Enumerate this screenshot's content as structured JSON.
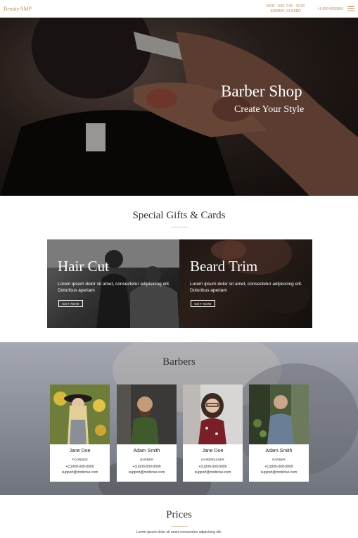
{
  "nav": {
    "brand": "BeautyAMP",
    "hours_line1": "MON - SAT: 7:00 - 10:00",
    "hours_line2": "SUNDAY: CLOSED",
    "phone": "+1-000-0000000"
  },
  "hero": {
    "title": "Barber Shop",
    "subtitle": "Create Your Style"
  },
  "gifts": {
    "title": "Special Gifts & Cards",
    "cards": [
      {
        "title": "Hair Cut",
        "text": "Lorem ipsum dolor sit amet, consectetur adipisicing elit. Doloribus aperiam",
        "button": "GET NOW"
      },
      {
        "title": "Beard Trim",
        "text": "Lorem ipsum dolor sit amet, consectetur adipisicing elit. Doloribus aperiam",
        "button": "GET NOW"
      }
    ]
  },
  "barbers": {
    "title": "Barbers",
    "members": [
      {
        "name": "Jane Doe",
        "role": "FOUNDER",
        "phone": "+(1)000-000-0000",
        "email": "support@mobirise.com"
      },
      {
        "name": "Adam Smith",
        "role": "BARBER",
        "phone": "+(1)000-000-0000",
        "email": "support@mobirise.com"
      },
      {
        "name": "Jane Doe",
        "role": "HAIRDRESSER",
        "phone": "+(1)000-000-0000",
        "email": "support@mobirise.com"
      },
      {
        "name": "Adam Smith",
        "role": "BARBER",
        "phone": "+(1)000-000-0000",
        "email": "support@mobirise.com"
      }
    ]
  },
  "prices": {
    "title": "Prices",
    "subtitle": "Lorem ipsum dolor sit amet consectetur adipisicing elit."
  },
  "colors": {
    "accent": "#b98e5b",
    "divider": "#e1c8a9"
  }
}
